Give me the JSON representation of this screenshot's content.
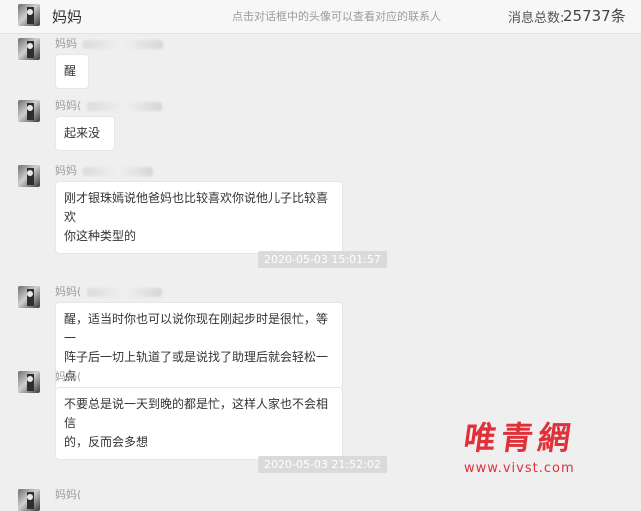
{
  "header": {
    "contact_name": "妈妈",
    "hint": "点击对话框中的头像可以查看对应的联系人",
    "total_label": "消息总数:",
    "total_count": "25737条"
  },
  "messages": [
    {
      "sender": "妈妈",
      "text": "醒"
    },
    {
      "sender": "妈妈(",
      "text": "起来没"
    },
    {
      "sender": "妈妈",
      "lines": [
        "刚才银珠嫣说他爸妈也比较喜欢你说他儿子比较喜欢",
        "你这种类型的"
      ]
    },
    {
      "sender": "妈妈(",
      "lines": [
        "醒，适当时你也可以说你现在刚起步时是很忙，等一",
        "阵子后一切上轨道了或是说找了助理后就会轻松一点"
      ]
    },
    {
      "sender": "妈妈(",
      "lines": [
        "不要总是说一天到晚的都是忙，这样人家也不会相信",
        "的，反而会多想"
      ]
    },
    {
      "sender": "妈妈("
    }
  ],
  "timestamps": [
    "2020-05-03 15:01:57",
    "2020-05-03 21:52:02"
  ],
  "watermark": {
    "title": "唯青網",
    "url": "www.vivst.com"
  },
  "colors": {
    "background": "#efefef",
    "bubble": "#ffffff",
    "timestamp_bg": "#dadada",
    "watermark": "#e0313a"
  }
}
